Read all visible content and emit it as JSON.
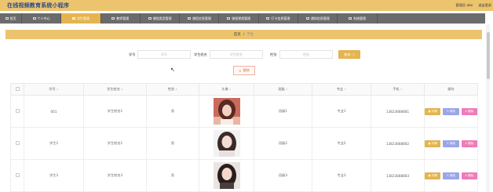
{
  "app": {
    "title": "在线视频教育系统小程序",
    "user": "管理员 abo",
    "logout": "退出登录"
  },
  "nav": [
    {
      "label": "首页",
      "icon": "home-icon",
      "active": false
    },
    {
      "label": "个人中心",
      "icon": "person-icon",
      "active": false
    },
    {
      "label": "学生管理",
      "icon": "student-icon",
      "active": true
    },
    {
      "label": "教师管理",
      "icon": "teacher-icon",
      "active": false
    },
    {
      "label": "课程类型管理",
      "icon": "category-icon",
      "active": false
    },
    {
      "label": "课程信息管理",
      "icon": "course-icon",
      "active": false
    },
    {
      "label": "课程视频管理",
      "icon": "video-icon",
      "active": false
    },
    {
      "label": "打卡信息管理",
      "icon": "checkin-icon",
      "active": false
    },
    {
      "label": "通知信息管理",
      "icon": "notice-icon",
      "active": false
    },
    {
      "label": "系统管理",
      "icon": "settings-icon",
      "active": false
    }
  ],
  "breadcrumb": {
    "home": "首页",
    "sep": "/",
    "current": "学生"
  },
  "search": {
    "id_label": "学号",
    "id_placeholder": "学号",
    "name_label": "学生姓名",
    "name_placeholder": "学生姓名",
    "gender_label": "性别",
    "gender_placeholder": "性别",
    "button": "查询"
  },
  "delete_button": "删除",
  "table": {
    "headers": [
      "学号",
      "学生姓名",
      "性别",
      "头像",
      "班级",
      "专业",
      "手机",
      "操作"
    ],
    "rows": [
      {
        "id": "001",
        "name": "学生姓名1",
        "gender": "男",
        "class": "班级1",
        "major": "专业1",
        "phone": "13823888881",
        "avatar": "avatar-1"
      },
      {
        "id": "学生2",
        "name": "学生姓名2",
        "gender": "男",
        "class": "班级2",
        "major": "专业2",
        "phone": "13823888882",
        "avatar": "avatar-2"
      },
      {
        "id": "学生3",
        "name": "学生姓名3",
        "gender": "男",
        "class": "班级3",
        "major": "专业3",
        "phone": "13823888883",
        "avatar": "avatar-3"
      }
    ],
    "actions": {
      "detail": "详情",
      "edit": "修改",
      "remove": "删除"
    }
  },
  "colors": {
    "header": "#ecc46e",
    "nav": "#6b6b6b",
    "accent": "#e4b44f",
    "edit": "#9aa6e8",
    "remove": "#f07bb8"
  }
}
